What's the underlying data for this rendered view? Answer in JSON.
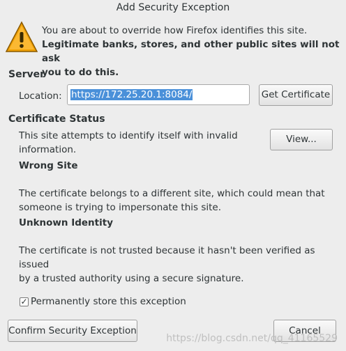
{
  "window": {
    "title": "Add Security Exception"
  },
  "intro": {
    "line1": "You are about to override how Firefox identifies this site.",
    "line2": "Legitimate banks, stores, and other public sites will not ask",
    "line3": "you to do this."
  },
  "server": {
    "heading": "Server",
    "location_label": "Location:",
    "location_value": "https://172.25.20.1:8084/",
    "get_certificate_label": "Get Certificate"
  },
  "status": {
    "heading": "Certificate Status",
    "summary_line1": "This site attempts to identify itself with invalid",
    "summary_line2": "information.",
    "view_label": "View...",
    "wrong_site_title": "Wrong Site",
    "wrong_site_line1": "The certificate belongs to a different site, which could mean that",
    "wrong_site_line2": "someone is trying to impersonate this site.",
    "unknown_identity_title": "Unknown Identity",
    "unknown_identity_line1": "The certificate is not trusted because it hasn't been verified as issued",
    "unknown_identity_line2": "by a trusted authority using a secure signature."
  },
  "options": {
    "permanent_label": "Permanently store this exception",
    "permanent_checked": true
  },
  "actions": {
    "confirm_label": "Confirm Security Exception",
    "cancel_label": "Cancel"
  },
  "watermark": "https://blog.csdn.net/qq_41165529",
  "icons": {
    "warning": "warning-triangle-icon",
    "checkbox": "checkmark-icon"
  },
  "colors": {
    "selection": "#4a90d9",
    "warning": "#f0a000"
  }
}
